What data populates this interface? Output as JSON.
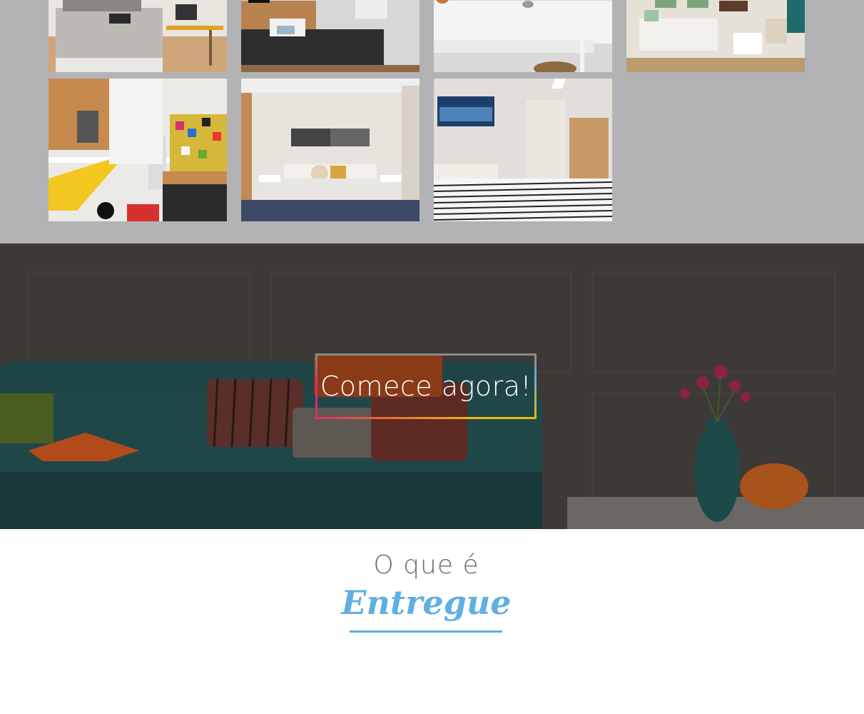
{
  "gallery": {
    "items": [
      {
        "alt": "bedroom-with-desk-icon"
      },
      {
        "alt": "bedroom-dark-bedspread-icon"
      },
      {
        "alt": "bathroom-sink-icon"
      },
      {
        "alt": "living-room-icon"
      },
      {
        "alt": "kitchen-colorful-tiles-icon"
      },
      {
        "alt": "bedroom-navy-blanket-icon"
      },
      {
        "alt": "bedroom-striped-bedding-icon"
      }
    ]
  },
  "hero": {
    "cta_label": "Comece agora!"
  },
  "what_is": {
    "pre_title": "O que é",
    "title": "Entregue"
  },
  "colors": {
    "gallery_bg": "#b3b3b5",
    "accent_blue": "#5fb0e0",
    "accent_pink": "#d1306f",
    "accent_yellow": "#f2b705"
  }
}
